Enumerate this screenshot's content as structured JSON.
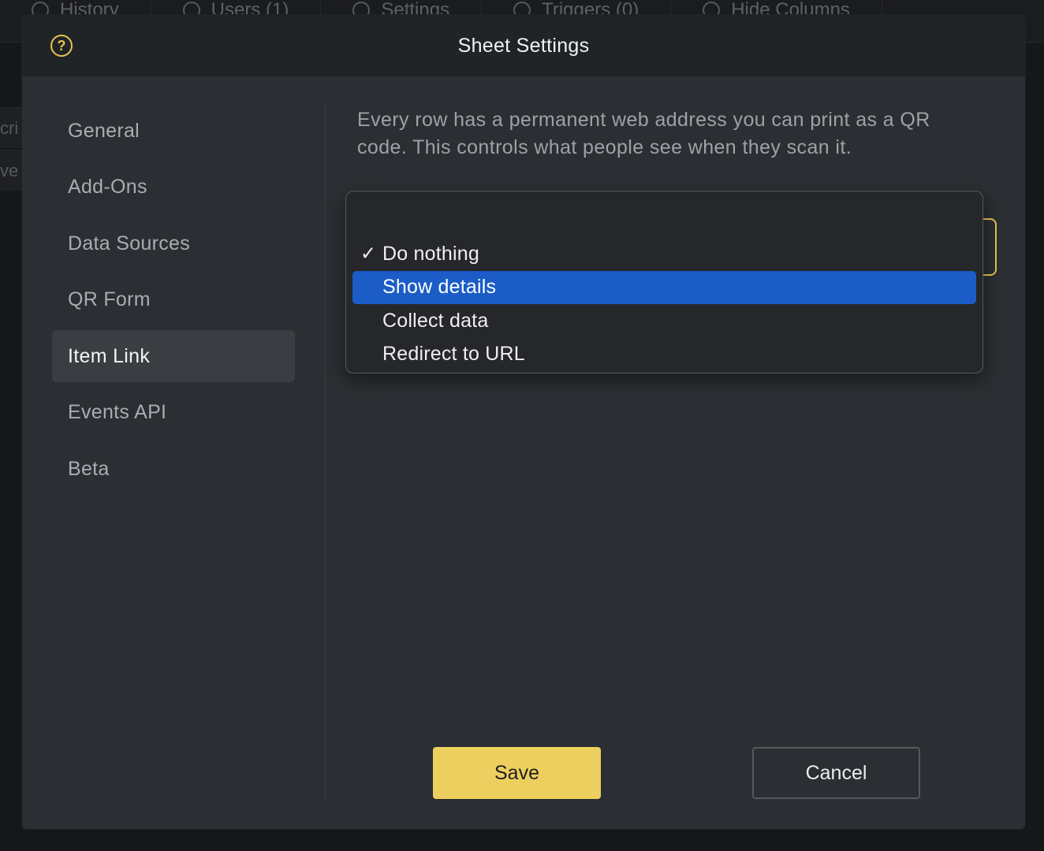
{
  "background": {
    "toolbar": [
      {
        "label": "History",
        "icon": "clock-icon"
      },
      {
        "label": "Users (1)",
        "icon": "user-icon"
      },
      {
        "label": "Settings",
        "icon": "gear-icon"
      },
      {
        "label": "Triggers (0)",
        "icon": "robot-icon"
      },
      {
        "label": "Hide Columns",
        "icon": "eye-off-icon"
      }
    ],
    "left_fragments": [
      "cri",
      "ve"
    ]
  },
  "modal": {
    "title": "Sheet Settings",
    "help_icon": "question-circle-icon",
    "sidebar": {
      "items": [
        {
          "label": "General"
        },
        {
          "label": "Add-Ons"
        },
        {
          "label": "Data Sources"
        },
        {
          "label": "QR Form"
        },
        {
          "label": "Item Link",
          "active": true
        },
        {
          "label": "Events API"
        },
        {
          "label": "Beta"
        }
      ]
    },
    "content": {
      "description": "Every row has a permanent web address you can print as a QR code. This controls what people see when they scan it.",
      "dropdown": {
        "selected": "Do nothing",
        "highlighted": "Show details",
        "options": [
          "Do nothing",
          "Show details",
          "Collect data",
          "Redirect to URL"
        ]
      }
    },
    "buttons": {
      "save": "Save",
      "cancel": "Cancel"
    }
  },
  "colors": {
    "accent": "#edcf5f",
    "highlight": "#1b5cc7",
    "modal_bg": "#2b2e32",
    "header_bg": "#212427"
  }
}
